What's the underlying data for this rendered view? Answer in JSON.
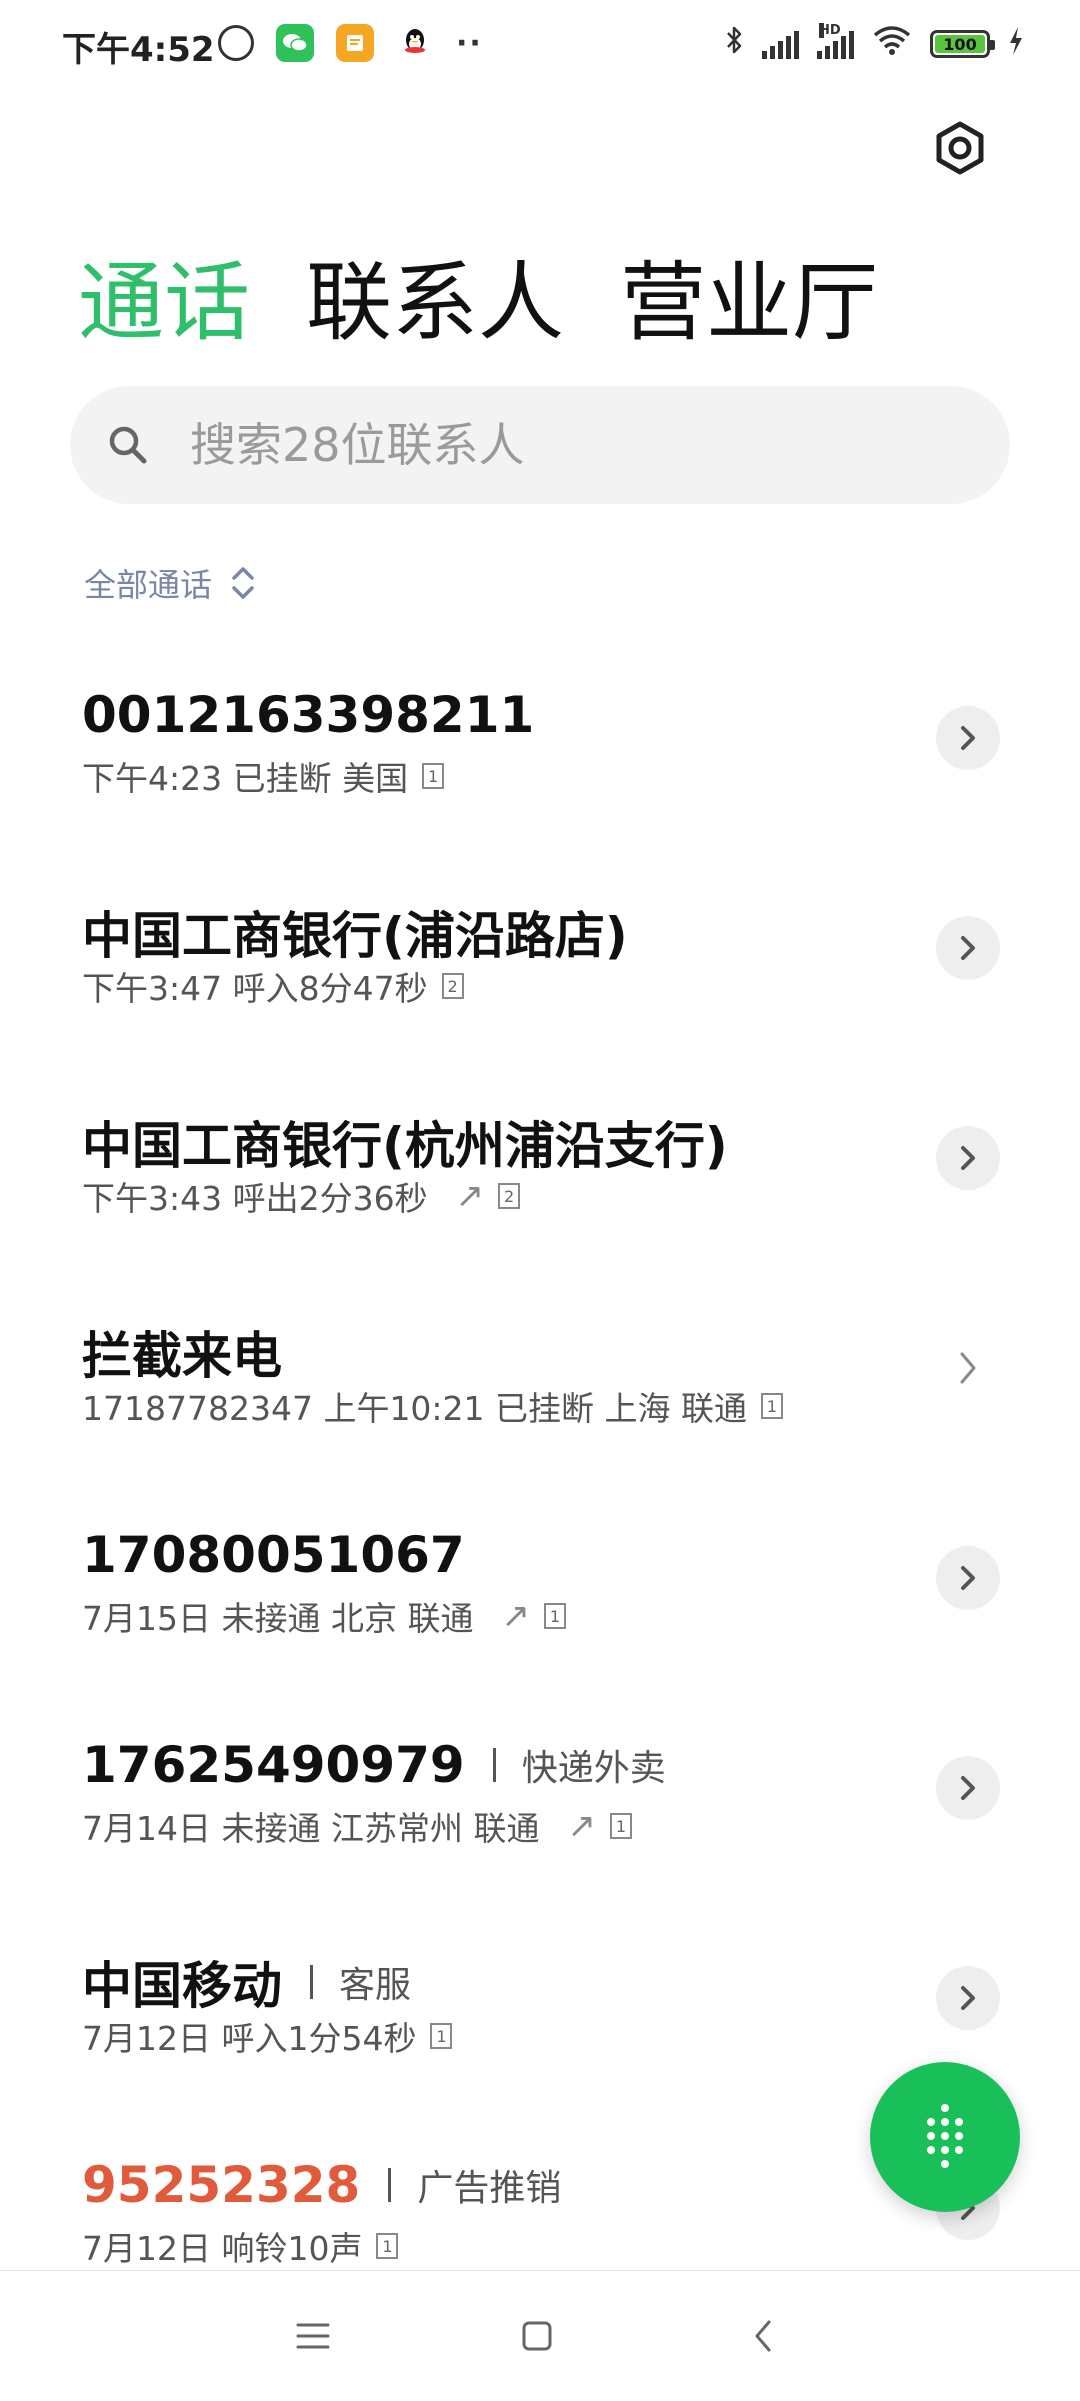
{
  "status_bar": {
    "time": "下午4:52",
    "hd_label": "HD",
    "battery_level": "100",
    "battery_fill_fraction": 1.0
  },
  "tabs": [
    {
      "label": "通话",
      "active": true
    },
    {
      "label": "联系人",
      "active": false
    },
    {
      "label": "营业厅",
      "active": false
    }
  ],
  "search": {
    "placeholder": "搜索28位联系人"
  },
  "filter": {
    "label": "全部通话"
  },
  "calls": [
    {
      "name": "0012163398211",
      "tag": "",
      "detail": "下午4:23 已挂断 美国",
      "outgoing": false,
      "sim": "1"
    },
    {
      "name": "中国工商银行(浦沿路店)",
      "tag": "",
      "detail": "下午3:47 呼入8分47秒",
      "outgoing": false,
      "sim": "2"
    },
    {
      "name": "中国工商银行(杭州浦沿支行)",
      "tag": "",
      "detail": "下午3:43 呼出2分36秒",
      "outgoing": true,
      "sim": "2"
    },
    {
      "name": "拦截来电",
      "tag": "",
      "detail": "17187782347 上午10:21 已挂断 上海 联通",
      "outgoing": false,
      "sim": "1"
    },
    {
      "name": "17080051067",
      "tag": "",
      "detail": "7月15日 未接通 北京 联通",
      "outgoing": true,
      "sim": "1"
    },
    {
      "name": "17625490979",
      "tag": "快递外卖",
      "detail": "7月14日 未接通 江苏常州 联通",
      "outgoing": true,
      "sim": "1"
    },
    {
      "name": "中国移动",
      "tag": "客服",
      "detail": "7月12日 呼入1分54秒",
      "outgoing": false,
      "sim": "1"
    },
    {
      "name": "95252328",
      "tag": "广告推销",
      "detail": "7月12日 响铃10声",
      "outgoing": false,
      "sim": "1"
    }
  ],
  "colors": {
    "accent_green": "#2fbf6b",
    "fab_green": "#19c05a",
    "spam_red": "#e05a3c",
    "filter_blue_gray": "#7a86a8"
  },
  "icons": {
    "settings": "settings-gear-icon",
    "search": "search-icon",
    "filter": "expand-collapse-icon",
    "fab": "dialpad-icon",
    "nav_menu": "menu-icon",
    "nav_home": "home-icon",
    "nav_back": "back-icon"
  }
}
